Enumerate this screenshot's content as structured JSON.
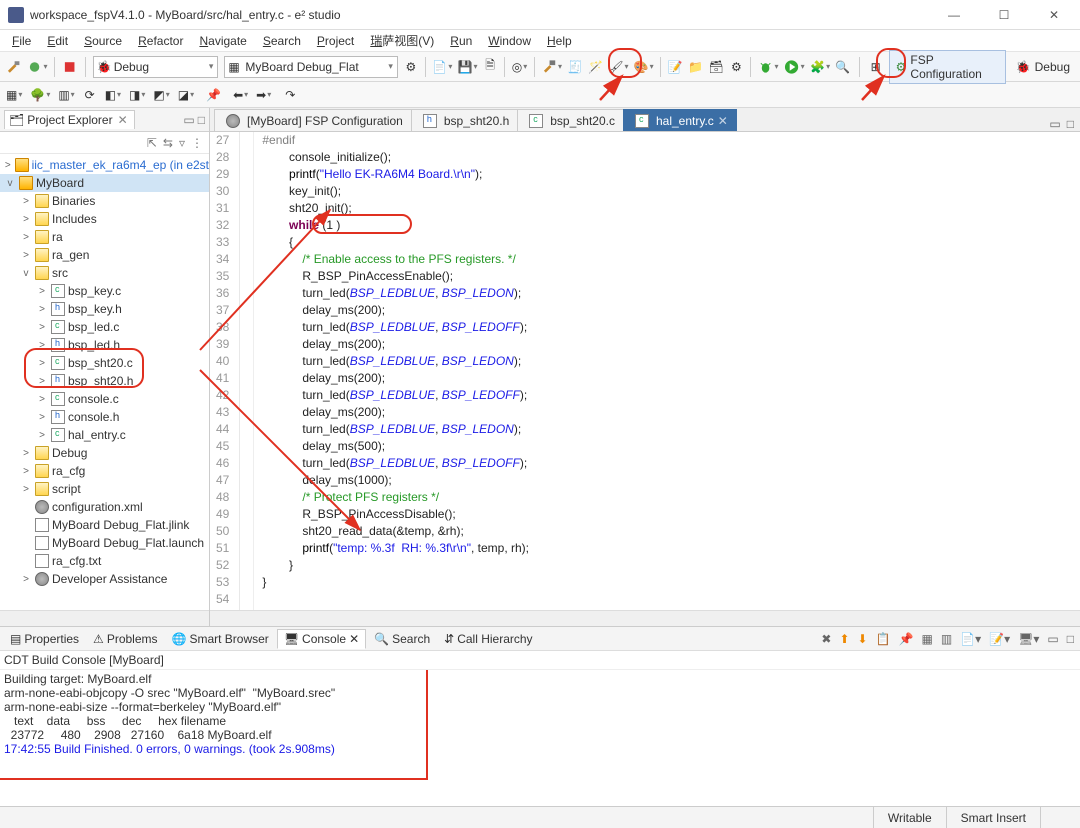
{
  "window": {
    "title": "workspace_fspV4.1.0 - MyBoard/src/hal_entry.c - e² studio"
  },
  "menu": [
    "File",
    "Edit",
    "Source",
    "Refactor",
    "Navigate",
    "Search",
    "Project",
    "瑞萨视图(V)",
    "Run",
    "Window",
    "Help"
  ],
  "toolbar": {
    "debug_combo": "Debug",
    "launch_combo": "MyBoard Debug_Flat",
    "fsp_btn": "FSP Configuration",
    "debug_persp": "Debug"
  },
  "explorer": {
    "title": "Project Explorer",
    "items": [
      {
        "d": 0,
        "tw": ">",
        "icon": "prj",
        "label": "iic_master_ek_ra6m4_ep",
        "suffix": "(in e2st",
        "link": true
      },
      {
        "d": 0,
        "tw": "v",
        "icon": "prj",
        "label": "MyBoard",
        "sel": true
      },
      {
        "d": 1,
        "tw": ">",
        "icon": "fold",
        "label": "Binaries"
      },
      {
        "d": 1,
        "tw": ">",
        "icon": "fold",
        "label": "Includes"
      },
      {
        "d": 1,
        "tw": ">",
        "icon": "fold",
        "label": "ra"
      },
      {
        "d": 1,
        "tw": ">",
        "icon": "fold",
        "label": "ra_gen"
      },
      {
        "d": 1,
        "tw": "v",
        "icon": "fold",
        "label": "src"
      },
      {
        "d": 2,
        "tw": ">",
        "icon": "c",
        "label": "bsp_key.c"
      },
      {
        "d": 2,
        "tw": ">",
        "icon": "h",
        "label": "bsp_key.h"
      },
      {
        "d": 2,
        "tw": ">",
        "icon": "c",
        "label": "bsp_led.c"
      },
      {
        "d": 2,
        "tw": ">",
        "icon": "h",
        "label": "bsp_led.h"
      },
      {
        "d": 2,
        "tw": ">",
        "icon": "c",
        "label": "bsp_sht20.c",
        "ring": true
      },
      {
        "d": 2,
        "tw": ">",
        "icon": "h",
        "label": "bsp_sht20.h",
        "ring": true
      },
      {
        "d": 2,
        "tw": ">",
        "icon": "c",
        "label": "console.c"
      },
      {
        "d": 2,
        "tw": ">",
        "icon": "h",
        "label": "console.h"
      },
      {
        "d": 2,
        "tw": ">",
        "icon": "c",
        "label": "hal_entry.c"
      },
      {
        "d": 1,
        "tw": ">",
        "icon": "fold",
        "label": "Debug"
      },
      {
        "d": 1,
        "tw": ">",
        "icon": "fold",
        "label": "ra_cfg"
      },
      {
        "d": 1,
        "tw": ">",
        "icon": "fold",
        "label": "script"
      },
      {
        "d": 1,
        "tw": "",
        "icon": "gear",
        "label": "configuration.xml"
      },
      {
        "d": 1,
        "tw": "",
        "icon": "file",
        "label": "MyBoard Debug_Flat.jlink"
      },
      {
        "d": 1,
        "tw": "",
        "icon": "file",
        "label": "MyBoard Debug_Flat.launch"
      },
      {
        "d": 1,
        "tw": "",
        "icon": "file",
        "label": "ra_cfg.txt"
      },
      {
        "d": 1,
        "tw": ">",
        "icon": "gear",
        "label": "Developer Assistance"
      }
    ]
  },
  "editor_tabs": [
    {
      "label": "[MyBoard] FSP Configuration",
      "icon": "gear"
    },
    {
      "label": "bsp_sht20.h",
      "icon": "h"
    },
    {
      "label": "bsp_sht20.c",
      "icon": "c"
    },
    {
      "label": "hal_entry.c",
      "icon": "c",
      "active": true
    }
  ],
  "code": {
    "first_line": 27,
    "lines": [
      {
        "t": "#endif",
        "cls": "pp"
      },
      {
        "t": ""
      },
      {
        "t": "        console_initialize();"
      },
      {
        "t": "        printf(\"Hello EK-RA6M4 Board.\\r\\n\");",
        "seg": [
          [
            "        ",
            ""
          ],
          [
            "printf",
            "fn"
          ],
          [
            "(",
            ""
          ],
          [
            "\"Hello EK-RA6M4 Board.\\r\\n\"",
            "str"
          ],
          [
            ");",
            ""
          ]
        ]
      },
      {
        "t": "        key_init();"
      },
      {
        "t": "        sht20_init();",
        "ring": true
      },
      {
        "t": ""
      },
      {
        "t": "        while (1)",
        "seg": [
          [
            "        ",
            ""
          ],
          [
            "while",
            "kw"
          ],
          [
            " (",
            ""
          ],
          [
            "1",
            ""
          ],
          [
            " )",
            ""
          ]
        ]
      },
      {
        "t": "        {"
      },
      {
        "t": "            /* Enable access to the PFS registers. */",
        "cls": "cm"
      },
      {
        "t": "            R_BSP_PinAccessEnable();"
      },
      {
        "t": ""
      },
      {
        "t": "            turn_led(BSP_LEDBLUE, BSP_LEDON);",
        "seg": [
          [
            "            turn_led(",
            ""
          ],
          [
            "BSP_LEDBLUE",
            "sym"
          ],
          [
            ", ",
            ""
          ],
          [
            "BSP_LEDON",
            "sym"
          ],
          [
            ");",
            ""
          ]
        ]
      },
      {
        "t": "            delay_ms(200);"
      },
      {
        "t": "            turn_led(BSP_LEDBLUE, BSP_LEDOFF);",
        "seg": [
          [
            "            turn_led(",
            ""
          ],
          [
            "BSP_LEDBLUE",
            "sym"
          ],
          [
            ", ",
            ""
          ],
          [
            "BSP_LEDOFF",
            "sym"
          ],
          [
            ");",
            ""
          ]
        ]
      },
      {
        "t": "            delay_ms(200);"
      },
      {
        "t": ""
      },
      {
        "t": "            turn_led(BSP_LEDBLUE, BSP_LEDON);",
        "seg": [
          [
            "            turn_led(",
            ""
          ],
          [
            "BSP_LEDBLUE",
            "sym"
          ],
          [
            ", ",
            ""
          ],
          [
            "BSP_LEDON",
            "sym"
          ],
          [
            ");",
            ""
          ]
        ]
      },
      {
        "t": "            delay_ms(200);"
      },
      {
        "t": "            turn_led(BSP_LEDBLUE, BSP_LEDOFF);",
        "seg": [
          [
            "            turn_led(",
            ""
          ],
          [
            "BSP_LEDBLUE",
            "sym"
          ],
          [
            ", ",
            ""
          ],
          [
            "BSP_LEDOFF",
            "sym"
          ],
          [
            ");",
            ""
          ]
        ]
      },
      {
        "t": "            delay_ms(200);"
      },
      {
        "t": ""
      },
      {
        "t": "            turn_led(BSP_LEDBLUE, BSP_LEDON);",
        "seg": [
          [
            "            turn_led(",
            ""
          ],
          [
            "BSP_LEDBLUE",
            "sym"
          ],
          [
            ", ",
            ""
          ],
          [
            "BSP_LEDON",
            "sym"
          ],
          [
            ");",
            ""
          ]
        ]
      },
      {
        "t": "            delay_ms(500);"
      },
      {
        "t": "            turn_led(BSP_LEDBLUE, BSP_LEDOFF);",
        "seg": [
          [
            "            turn_led(",
            ""
          ],
          [
            "BSP_LEDBLUE",
            "sym"
          ],
          [
            ", ",
            ""
          ],
          [
            "BSP_LEDOFF",
            "sym"
          ],
          [
            ");",
            ""
          ]
        ]
      },
      {
        "t": "            delay_ms(1000);"
      },
      {
        "t": ""
      },
      {
        "t": "            /* Protect PFS registers */",
        "cls": "cm"
      },
      {
        "t": "            R_BSP_PinAccessDisable();"
      },
      {
        "t": ""
      },
      {
        "t": "            sht20_read_data(&temp, &rh);"
      },
      {
        "t": "            printf(\"temp: %.3f  RH: %.3f\\r\\n\", temp, rh);",
        "seg": [
          [
            "            ",
            ""
          ],
          [
            "printf",
            "fn"
          ],
          [
            "(",
            ""
          ],
          [
            "\"temp: %.3f  RH: %.3f\\r\\n\"",
            "str"
          ],
          [
            ", temp, rh);",
            ""
          ]
        ]
      },
      {
        "t": "        }"
      },
      {
        "t": "}"
      },
      {
        "t": ""
      }
    ]
  },
  "bottom_tabs": [
    "Properties",
    "Problems",
    "Smart Browser",
    "Console",
    "Search",
    "Call Hierarchy"
  ],
  "bottom_active": 3,
  "console_title": "CDT Build Console [MyBoard]",
  "console_lines": [
    "Building target: MyBoard.elf",
    "arm-none-eabi-objcopy -O srec \"MyBoard.elf\"  \"MyBoard.srec\"",
    "arm-none-eabi-size --format=berkeley \"MyBoard.elf\"",
    "   text    data     bss     dec     hex filename",
    "  23772     480    2908   27160    6a18 MyBoard.elf",
    "",
    "17:42:55 Build Finished. 0 errors, 0 warnings. (took 2s.908ms)",
    ""
  ],
  "status": {
    "writable": "Writable",
    "insert": "Smart Insert"
  }
}
